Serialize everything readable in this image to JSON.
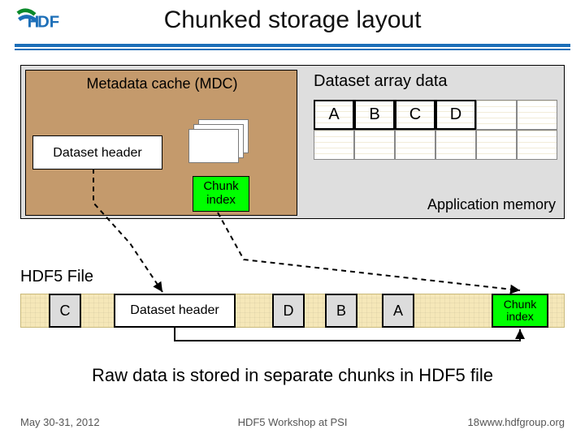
{
  "title": "Chunked storage layout",
  "appmem": {
    "mdc_title": "Metadata cache (MDC)",
    "dataset_header": "Dataset header",
    "chunk_index": "Chunk\nindex",
    "array_title": "Dataset array data",
    "chunks": [
      "A",
      "B",
      "C",
      "D"
    ],
    "label": "Application memory"
  },
  "file": {
    "label": "HDF5 File",
    "c": "C",
    "dataset_header": "Dataset header",
    "d": "D",
    "b": "B",
    "a": "A",
    "chunk_index": "Chunk\nindex"
  },
  "caption": "Raw data is stored in separate chunks in HDF5 file",
  "footer": {
    "date": "May 30-31, 2012",
    "mid": "HDF5 Workshop at PSI",
    "page": "18",
    "url": "www.hdfgroup.org"
  }
}
